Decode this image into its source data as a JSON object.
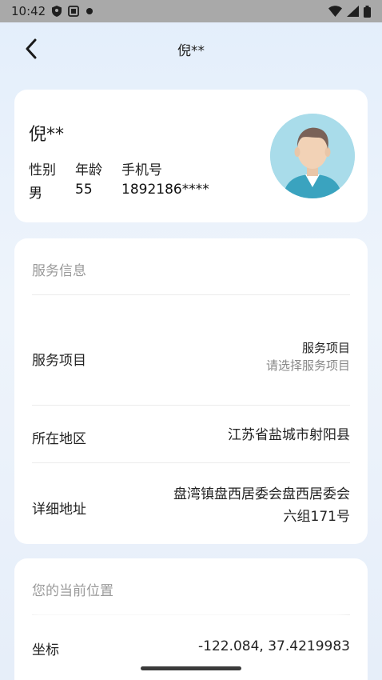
{
  "status_bar": {
    "time": "10:42"
  },
  "nav": {
    "title": "倪**"
  },
  "profile": {
    "name": "倪**",
    "gender_label": "性别",
    "gender_value": "男",
    "age_label": "年龄",
    "age_value": "55",
    "phone_label": "手机号",
    "phone_value": "1892186****"
  },
  "service": {
    "section_title": "服务信息",
    "item_label": "服务项目",
    "item_value_title": "服务项目",
    "item_value_placeholder": "请选择服务项目",
    "region_label": "所在地区",
    "region_value": "江苏省盐城市射阳县",
    "address_label": "详细地址",
    "address_line1": "盘湾镇盘西居委会盘西居委会",
    "address_line2": "六组171号"
  },
  "location": {
    "section_title": "您的当前位置",
    "coord_label": "坐标",
    "coord_value": "-122.084, 37.4219983"
  }
}
